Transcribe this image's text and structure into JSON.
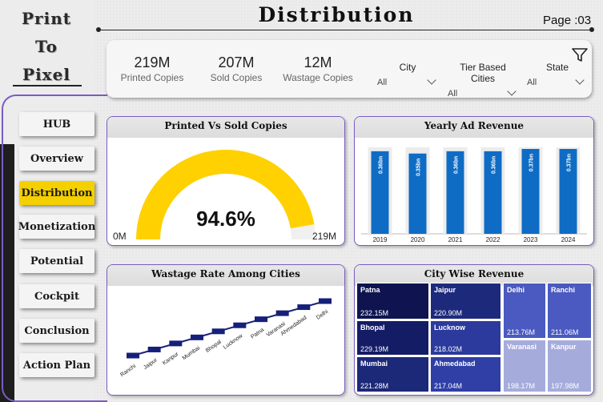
{
  "brand": {
    "line1": "Print",
    "line2": "To",
    "line3": "Pixel"
  },
  "header": {
    "title": "Distribution",
    "page": "Page :03"
  },
  "nav": [
    {
      "label": "HUB",
      "active": false
    },
    {
      "label": "Overview",
      "active": false
    },
    {
      "label": "Distribution",
      "active": true
    },
    {
      "label": "Monetization",
      "active": false
    },
    {
      "label": "Potential",
      "active": false
    },
    {
      "label": "Cockpit",
      "active": false
    },
    {
      "label": "Conclusion",
      "active": false
    },
    {
      "label": "Action Plan",
      "active": false
    }
  ],
  "kpis": [
    {
      "value": "219M",
      "label": "Printed Copies"
    },
    {
      "value": "207M",
      "label": "Sold Copies"
    },
    {
      "value": "12M",
      "label": "Wastage Copies"
    }
  ],
  "filters": [
    {
      "label": "City",
      "value": "All"
    },
    {
      "label": "Tier Based Cities",
      "value": "All"
    },
    {
      "label": "State",
      "value": "All"
    }
  ],
  "filter_icon": "funnel-icon",
  "colors": {
    "accent": "#7b5cc0",
    "gauge": "#ffd100",
    "bar": "#0f6cc5",
    "line": "#16207a"
  },
  "charts": {
    "gauge": {
      "title": "Printed Vs Sold Copies",
      "value_label": "94.6%",
      "min_label": "0M",
      "max_label": "219M"
    },
    "yearly": {
      "title": "Yearly Ad Revenue"
    },
    "wastage": {
      "title": "Wastage Rate Among Cities"
    },
    "city": {
      "title": "City Wise Revenue"
    }
  },
  "chart_data": [
    {
      "type": "gauge",
      "title": "Printed Vs Sold Copies",
      "value": 94.6,
      "min": 0,
      "max": 100,
      "min_label": "0M",
      "max_label": "219M"
    },
    {
      "type": "bar",
      "title": "Yearly Ad Revenue",
      "categories": [
        "2019",
        "2020",
        "2021",
        "2022",
        "2023",
        "2024"
      ],
      "values": [
        0.36,
        0.35,
        0.36,
        0.36,
        0.37,
        0.37
      ],
      "data_labels": [
        "0.36bn",
        "0.35bn",
        "0.36bn",
        "0.36bn",
        "0.37bn",
        "0.37bn"
      ]
    },
    {
      "type": "line",
      "title": "Wastage Rate Among Cities",
      "categories": [
        "Ranchi",
        "Jaipur",
        "Kanpur",
        "Mumbai",
        "Bhopal",
        "Lucknow",
        "Patna",
        "Varanasi",
        "Ahmedabad",
        "Delhi"
      ],
      "values": [
        1,
        2,
        3,
        4,
        5,
        6,
        7,
        8,
        9,
        10
      ]
    },
    {
      "type": "treemap",
      "title": "City Wise Revenue",
      "items": [
        {
          "city": "Patna",
          "label": "232.15M",
          "value": 232.15,
          "color": "#0f1450"
        },
        {
          "city": "Jaipur",
          "label": "220.90M",
          "value": 220.9,
          "color": "#1d2a7c"
        },
        {
          "city": "Bhopal",
          "label": "229.19M",
          "value": 229.19,
          "color": "#141c66"
        },
        {
          "city": "Lucknow",
          "label": "218.02M",
          "value": 218.02,
          "color": "#2b3a9c"
        },
        {
          "city": "Mumbai",
          "label": "221.28M",
          "value": 221.28,
          "color": "#1c2878"
        },
        {
          "city": "Ahmedabad",
          "label": "217.04M",
          "value": 217.04,
          "color": "#2f3fa6"
        },
        {
          "city": "Delhi",
          "label": "213.76M",
          "value": 213.76,
          "color": "#4a5ac0"
        },
        {
          "city": "Ranchi",
          "label": "211.06M",
          "value": 211.06,
          "color": "#4a5ac0"
        },
        {
          "city": "Varanasi",
          "label": "198.17M",
          "value": 198.17,
          "color": "#a5acdc"
        },
        {
          "city": "Kanpur",
          "label": "197.98M",
          "value": 197.98,
          "color": "#a5acdc"
        }
      ]
    }
  ]
}
